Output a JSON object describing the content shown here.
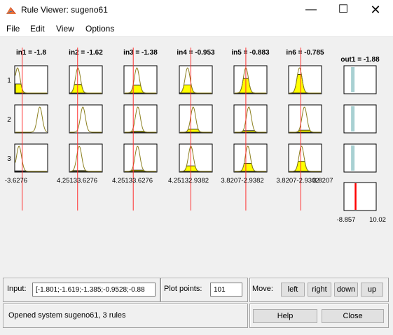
{
  "window": {
    "title": "Rule Viewer: sugeno61"
  },
  "menu": [
    "File",
    "Edit",
    "View",
    "Options"
  ],
  "inputs": [
    {
      "label": "in1 = -1.8",
      "min": "-3.6276",
      "max": "4.2513",
      "line": 0.228,
      "rules": [
        {
          "center": 0.085,
          "fill": 0.36
        },
        {
          "center": 0.76,
          "fill": 0.0
        },
        {
          "center": 0.13,
          "fill": 0.02
        }
      ]
    },
    {
      "label": "in2 = -1.62",
      "min": "3.6276",
      "max": "4.2513",
      "line": 0.25,
      "rules": [
        {
          "center": 0.26,
          "fill": 0.34
        },
        {
          "center": 0.41,
          "fill": 0.0
        },
        {
          "center": 0.3,
          "fill": 0.03
        }
      ]
    },
    {
      "label": "in3 = -1.38",
      "min": "3.6276",
      "max": "4.2513",
      "line": 0.281,
      "rules": [
        {
          "center": 0.39,
          "fill": 0.31
        },
        {
          "center": 0.42,
          "fill": 0.04
        },
        {
          "center": 0.41,
          "fill": 0.05
        }
      ]
    },
    {
      "label": "in4 = -0.953",
      "min": "2.9382",
      "max": "3.8207",
      "line": 0.35,
      "rules": [
        {
          "center": 0.25,
          "fill": 0.32
        },
        {
          "center": 0.42,
          "fill": 0.12
        },
        {
          "center": 0.35,
          "fill": 0.22
        }
      ]
    },
    {
      "label": "in5 = -0.883",
      "min": "2.9382",
      "max": "3.8207",
      "line": 0.36,
      "rules": [
        {
          "center": 0.36,
          "fill": 0.58
        },
        {
          "center": 0.45,
          "fill": 0.06
        },
        {
          "center": 0.42,
          "fill": 0.32
        }
      ]
    },
    {
      "label": "in6 = -0.785",
      "min": "2.9382",
      "max": "3.8207",
      "line": 0.37,
      "rules": [
        {
          "center": 0.33,
          "fill": 0.74
        },
        {
          "center": 0.48,
          "fill": 0.08
        },
        {
          "center": 0.39,
          "fill": 0.4
        }
      ]
    }
  ],
  "range_labels": [
    {
      "text": "-3.6276"
    },
    {
      "text": "4.25133.6276"
    },
    {
      "text": "4.25133.6276"
    },
    {
      "text": "4.25132.9382"
    },
    {
      "text": "3.8207-2.9382"
    },
    {
      "text": "3.8207-2.9382"
    },
    {
      "text": "3.8207"
    }
  ],
  "rule_numbers": [
    "1",
    "2",
    "3"
  ],
  "output": {
    "label": "out1 = -1.88",
    "min": "-8.857",
    "max": "10.02",
    "line": 0.36,
    "rule_bars": [
      0.22,
      0.22,
      0.22
    ]
  },
  "colors": {
    "curve": "#8b7f1e",
    "fill": "#ffff00",
    "line": "#ff3030",
    "out_bar": "#a8d0d2",
    "out_line": "#ff0000"
  },
  "controls": {
    "input_label": "Input:",
    "input_value": "[-1.801;-1.619;-1.385;-0.9528;-0.88",
    "plot_points_label": "Plot points:",
    "plot_points_value": "101",
    "move_label": "Move:",
    "left": "left",
    "right": "right",
    "down": "down",
    "up": "up",
    "help": "Help",
    "close": "Close",
    "status": "Opened system sugeno61, 3 rules"
  }
}
